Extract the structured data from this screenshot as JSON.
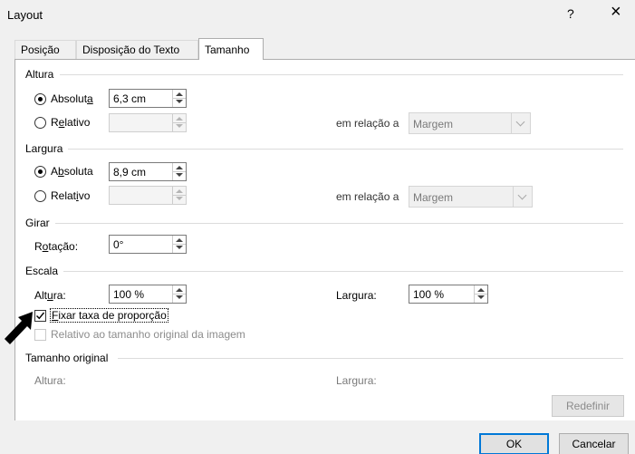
{
  "dialog": {
    "title": "Layout",
    "help": "?",
    "close": "×"
  },
  "tabs": [
    "Posição",
    "Disposição do Texto",
    "Tamanho"
  ],
  "sections": {
    "altura": "Altura",
    "largura": "Largura",
    "girar": "Girar",
    "escala": "Escala",
    "original": "Tamanho original"
  },
  "altura": {
    "abs_label_a": "Absolut",
    "abs_label_b": "a",
    "abs_value": "6,3 cm",
    "rel_label_a": "R",
    "rel_label_b": "e",
    "rel_label_c": "lativo",
    "relation_label": "em relação a",
    "relation_value": "Margem"
  },
  "largura": {
    "abs_label_a": "A",
    "abs_label_b": "b",
    "abs_label_c": "soluta",
    "abs_value": "8,9 cm",
    "rel_label_a": "Relat",
    "rel_label_b": "i",
    "rel_label_c": "vo",
    "relation_label": "em relação a",
    "relation_value": "Margem"
  },
  "girar": {
    "rot_label_a": "R",
    "rot_label_b": "o",
    "rot_label_c": "tação:",
    "rot_value": "0°"
  },
  "escala": {
    "alt_label_a": "Alt",
    "alt_label_b": "u",
    "alt_label_c": "ra:",
    "alt_value": "100 %",
    "larg_label_a": "Lar",
    "larg_label_b": "g",
    "larg_label_c": "ura:",
    "larg_value": "100 %",
    "lock_label_a": "F",
    "lock_label_b": "ixar taxa de proporção",
    "relative_label": "Relativo ao tamanho original da imagem"
  },
  "original": {
    "alt_label": "Altura:",
    "larg_label_a": "Lar",
    "larg_label_b": "g",
    "larg_label_c": "ura:",
    "reset": "Redefinir"
  },
  "buttons": {
    "ok": "OK",
    "cancel": "Cancelar"
  }
}
